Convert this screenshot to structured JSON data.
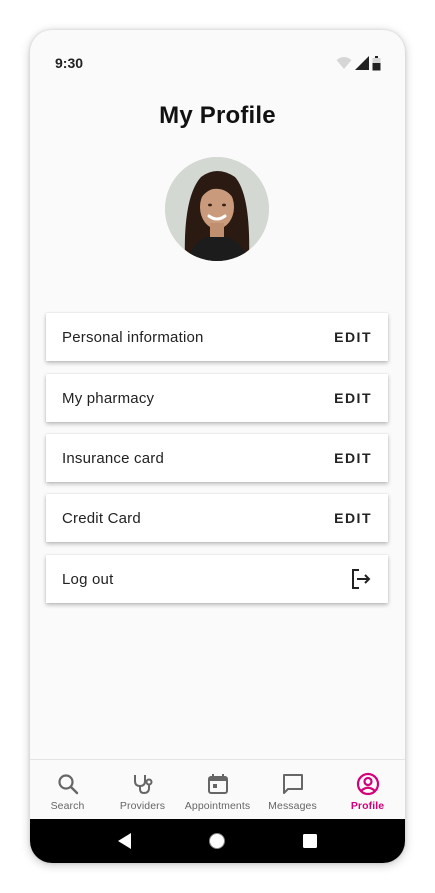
{
  "status_bar": {
    "time": "9:30"
  },
  "header": {
    "title": "My Profile"
  },
  "profile": {
    "avatar": "user-avatar-photo"
  },
  "menu": [
    {
      "label": "Personal information",
      "action": "EDIT"
    },
    {
      "label": "My pharmacy",
      "action": "EDIT"
    },
    {
      "label": "Insurance card",
      "action": "EDIT"
    },
    {
      "label": "Credit Card",
      "action": "EDIT"
    },
    {
      "label": "Log out",
      "action_icon": "logout-icon"
    }
  ],
  "bottom_nav": {
    "items": [
      {
        "label": "Search",
        "icon": "search-icon"
      },
      {
        "label": "Providers",
        "icon": "stethoscope-icon"
      },
      {
        "label": "Appointments",
        "icon": "calendar-icon"
      },
      {
        "label": "Messages",
        "icon": "message-icon"
      },
      {
        "label": "Profile",
        "icon": "account-circle-icon",
        "active": true
      }
    ]
  },
  "colors": {
    "accent": "#d4007a",
    "background": "#fafafa",
    "text": "#222222"
  }
}
